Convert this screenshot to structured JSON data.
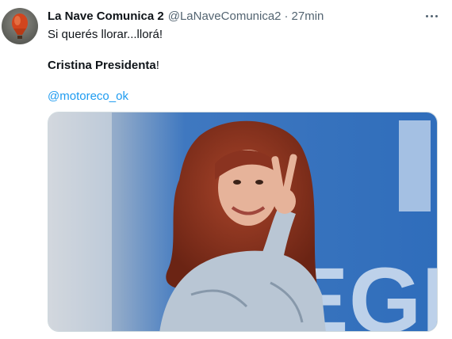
{
  "tweet": {
    "author_name": "La Nave Comunica 2",
    "author_handle": "@LaNaveComunica2",
    "separator": "·",
    "time": "27min",
    "text_line1": "Si querés llorar...llorá!",
    "text_line2_bold": "Cristina Presidenta",
    "text_line2_rest": "!",
    "mention": "@motoreco_ok"
  },
  "media": {
    "background_letters": "EGR"
  },
  "icons": {
    "avatar": "hot-air-balloon-avatar",
    "more": "more-options-icon"
  },
  "colors": {
    "link": "#1d9bf0",
    "secondary_text": "#536471",
    "primary_text": "#0f1419"
  }
}
